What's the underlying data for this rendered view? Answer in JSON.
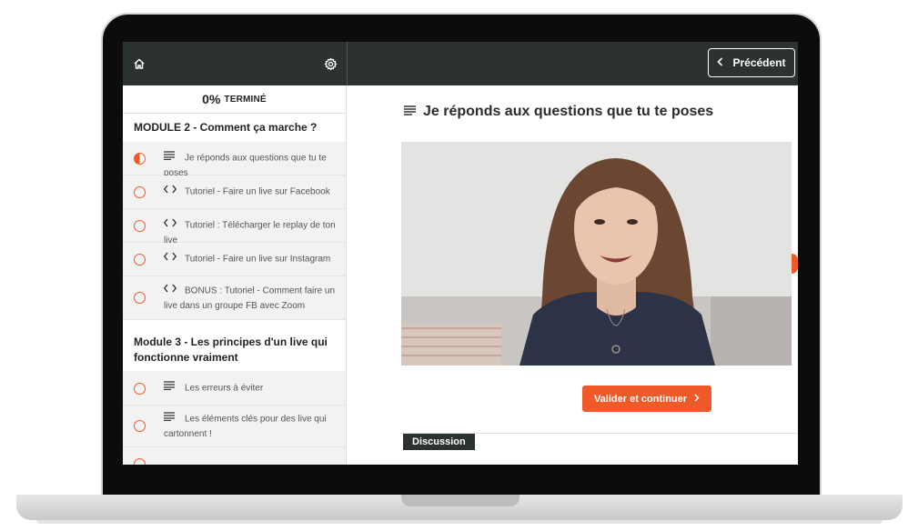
{
  "header": {
    "home_icon": "home-icon",
    "settings_icon": "gear-icon",
    "prev_label": "Précédent"
  },
  "sidebar": {
    "progress_pct": "0%",
    "progress_label": "TERMINÉ",
    "modules": [
      {
        "title": "MODULE 2 - Comment ça marche ?",
        "lessons": [
          {
            "label": "Je réponds aux questions que tu te poses",
            "icon": "text-lines-icon",
            "status": "in-progress"
          },
          {
            "label": "Tutoriel - Faire un live sur Facebook",
            "icon": "code-icon",
            "status": "not-started"
          },
          {
            "label": "Tutoriel : Télécharger le replay de ton live",
            "icon": "code-icon",
            "status": "not-started"
          },
          {
            "label": "Tutoriel - Faire un live sur Instagram",
            "icon": "code-icon",
            "status": "not-started"
          },
          {
            "label": "BONUS : Tutoriel - Comment faire un live dans un groupe FB avec Zoom",
            "icon": "code-icon",
            "status": "not-started"
          }
        ]
      },
      {
        "title": "Module 3 - Les principes d'un live qui fonctionne vraiment",
        "lessons": [
          {
            "label": "Les erreurs à éviter",
            "icon": "text-lines-icon",
            "status": "not-started"
          },
          {
            "label": "Les éléments clés pour des live qui cartonnent !",
            "icon": "text-lines-icon",
            "status": "not-started"
          }
        ]
      }
    ]
  },
  "main": {
    "lesson_title": "Je réponds aux questions que tu te poses",
    "continue_label": "Valider et continuer",
    "discussion_label": "Discussion"
  },
  "colors": {
    "accent": "#f05a28",
    "topbar": "#2c3231",
    "sidebar_bg": "#f2f2f2"
  }
}
